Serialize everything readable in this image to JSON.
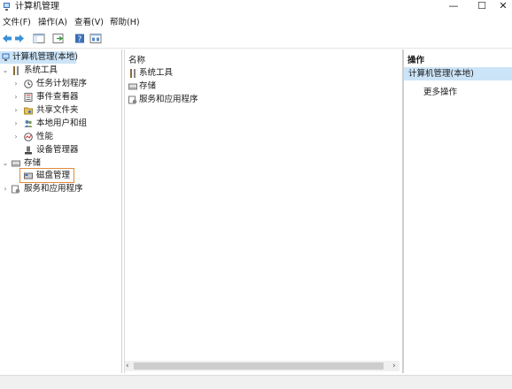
{
  "window": {
    "title": "计算机管理",
    "controls": {
      "minimize": "—",
      "maximize": "☐",
      "close": "✕"
    }
  },
  "menu": [
    {
      "label": "文件(F)"
    },
    {
      "label": "操作(A)"
    },
    {
      "label": "查看(V)"
    },
    {
      "label": "帮助(H)"
    }
  ],
  "toolbar": {
    "icons": [
      "back-arrow-icon",
      "forward-arrow-icon",
      "show-hide-tree-icon",
      "export-list-icon",
      "help-icon",
      "properties-icon"
    ]
  },
  "tree": {
    "root": "计算机管理(本地)",
    "system_tools": "系统工具",
    "task_scheduler": "任务计划程序",
    "event_viewer": "事件查看器",
    "shared_folders": "共享文件夹",
    "local_users": "本地用户和组",
    "performance": "性能",
    "device_manager": "设备管理器",
    "storage": "存储",
    "disk_management": "磁盘管理",
    "services_apps": "服务和应用程序"
  },
  "center": {
    "column_header": "名称",
    "items": [
      "系统工具",
      "存储",
      "服务和应用程序"
    ]
  },
  "actions": {
    "header": "操作",
    "section_title": "计算机管理(本地)",
    "more_actions": "更多操作"
  },
  "colors": {
    "selection": "#cce4f7",
    "highlight_box": "#e08a3c"
  }
}
